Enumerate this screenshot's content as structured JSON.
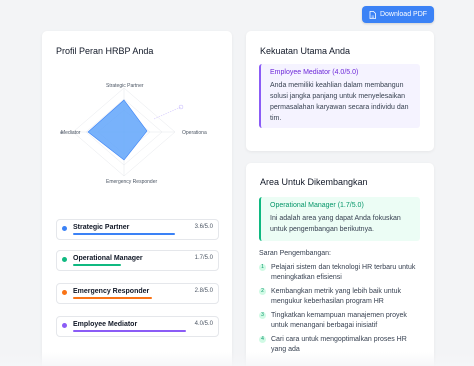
{
  "header": {
    "download_label": "Download PDF",
    "download_icon": "file-icon"
  },
  "profile": {
    "title": "Profil Peran HRBP Anda",
    "radar_axes": [
      "Strategic Partner",
      "Operationa",
      "Emergency Responder",
      "Mediator"
    ],
    "roles": [
      {
        "name": "Strategic Partner",
        "score_label": "3.6/5.0",
        "score": 3.6,
        "color": "#3b82f6"
      },
      {
        "name": "Operational Manager",
        "score_label": "1.7/5.0",
        "score": 1.7,
        "color": "#10b981"
      },
      {
        "name": "Emergency Responder",
        "score_label": "2.8/5.0",
        "score": 2.8,
        "color": "#f97316"
      },
      {
        "name": "Employee Mediator",
        "score_label": "4.0/5.0",
        "score": 4.0,
        "color": "#8b5cf6"
      }
    ]
  },
  "strength": {
    "title": "Kekuatan Utama Anda",
    "highlight_title": "Employee Mediator (4.0/5.0)",
    "highlight_text": "Anda memiliki keahlian dalam membangun solusi jangka panjang untuk menyelesaikan permasalahan karyawan secara individu dan tim.",
    "accent": "#8b5cf6"
  },
  "development": {
    "title": "Area Untuk Dikembangkan",
    "highlight_title": "Operational Manager (1.7/5.0)",
    "highlight_text": "Ini adalah area yang dapat Anda fokuskan untuk pengembangan berikutnya.",
    "accent": "#10b981",
    "suggestions_title": "Saran Pengembangan:",
    "suggestions": [
      {
        "num": "1",
        "text": "Pelajari sistem dan teknologi HR terbaru untuk meningkatkan efisiensi"
      },
      {
        "num": "2",
        "text": "Kembangkan metrik yang lebih baik untuk mengukur keberhasilan program HR"
      },
      {
        "num": "3",
        "text": "Tingkatkan kemampuan manajemen proyek untuk menangani berbagai inisiatif"
      },
      {
        "num": "4",
        "text": "Cari cara untuk mengoptimalkan proses HR yang ada"
      }
    ]
  }
}
